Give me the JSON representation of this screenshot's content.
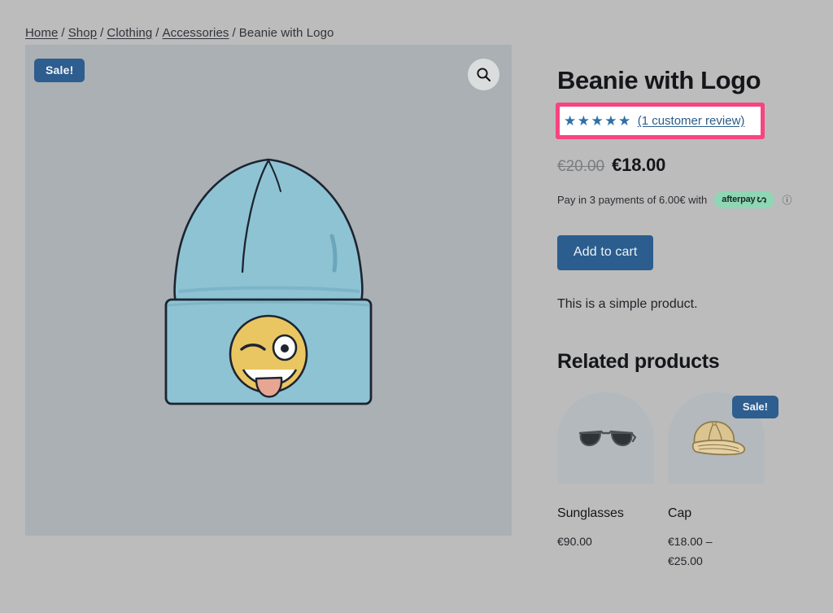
{
  "breadcrumb": {
    "items": [
      {
        "label": "Home",
        "link": true
      },
      {
        "label": "Shop",
        "link": true
      },
      {
        "label": "Clothing",
        "link": true
      },
      {
        "label": "Accessories",
        "link": true
      },
      {
        "label": "Beanie with Logo",
        "link": false
      }
    ],
    "separator": "/"
  },
  "gallery": {
    "sale_badge": "Sale!",
    "zoom_icon": "search-icon",
    "main_image_alt": "Beanie with Logo",
    "thumbnails": [
      {
        "alt": "beanie-thumbnail",
        "selected": true
      },
      {
        "alt": "hoodie-thumbnail",
        "selected": false
      }
    ]
  },
  "product": {
    "title": "Beanie with Logo",
    "stars": "★★★★★",
    "rating_value": 5,
    "review_link": "(1 customer review)",
    "price_old": "€20.00",
    "price_new": "€18.00",
    "installment_text": "Pay in 3 payments of 6.00€ with",
    "afterpay_label": "afterpay",
    "info_icon": "ⓘ",
    "add_to_cart": "Add to cart",
    "short_description": "This is a simple product."
  },
  "related": {
    "heading": "Related products",
    "products": [
      {
        "name": "Sunglasses",
        "price": "€90.00",
        "price_line2": "",
        "badge": "",
        "image_alt": "sunglasses-image"
      },
      {
        "name": "Cap",
        "price": "€18.00 –",
        "price_line2": "€25.00",
        "badge": "Sale!",
        "image_alt": "cap-image"
      }
    ]
  },
  "colors": {
    "page_bg": "#bcbcbc",
    "gallery_bg": "#aab0b3",
    "accent_blue": "#2b5d8e",
    "star_blue": "#2e6fa8",
    "afterpay_green": "#8fd6b4",
    "highlight_pink": "#f8447f"
  }
}
